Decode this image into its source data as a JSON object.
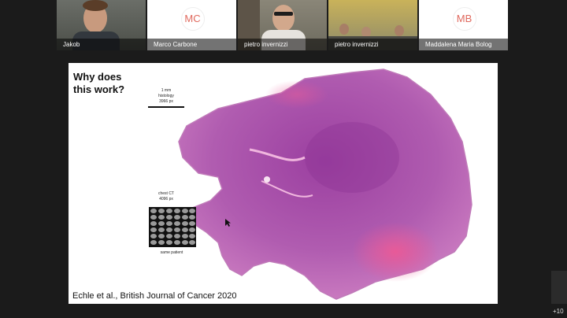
{
  "participants": [
    {
      "name": "Jakob",
      "type": "video"
    },
    {
      "name": "Marco Carbone",
      "type": "avatar",
      "initials": "MC"
    },
    {
      "name": "pietro invernizzi",
      "type": "video"
    },
    {
      "name": "pietro invernizzi",
      "type": "video"
    },
    {
      "name": "Maddalena Maria Bolog",
      "type": "avatar",
      "initials": "MB"
    }
  ],
  "slide": {
    "title_line1": "Why does",
    "title_line2": "this work?",
    "scale_line1": "1 mm",
    "scale_line2": "histology",
    "scale_line3": "3966 px",
    "ct_line1": "chest CT",
    "ct_line2": "4096 px",
    "ct_caption": "same patient",
    "citation": "Echle et al., British Journal of Cancer 2020"
  },
  "more_participants": "+10",
  "colors": {
    "avatar_text": "#e0695e",
    "tissue_dark": "#9b3fa0",
    "tissue_light": "#d486c6",
    "tissue_pink": "#e85a98"
  }
}
